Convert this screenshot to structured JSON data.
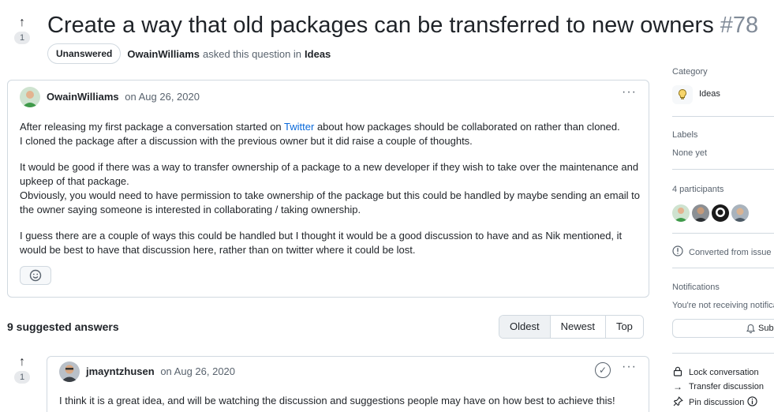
{
  "discussion": {
    "upvotes": "1",
    "title": "Create a way that old packages can be transferred to new owners",
    "number": "#78",
    "status": "Unanswered",
    "asker": "OwainWilliams",
    "asked_text": "asked this question in",
    "category": "Ideas"
  },
  "post": {
    "author": "OwainWilliams",
    "date": "on Aug 26, 2020",
    "more_icon": "kebab-horizontal-icon",
    "p1_before": "After releasing my first package a conversation started on ",
    "p1_link": "Twitter",
    "p1_after": " about how packages should be collaborated on rather than cloned.",
    "p1_line2": "I cloned the package after a discussion with the previous owner but it did raise a couple of thoughts.",
    "p2_line1": "It would be good if there was a way to transfer ownership of a package to a new developer if they wish to take over the maintenance and upkeep of that package.",
    "p2_line2": "Obviously, you would need to have permission to take ownership of the package but this could be handled by maybe sending an email to the owner saying someone is interested in collaborating / taking ownership.",
    "p3": "I guess there are a couple of ways this could be handled but I thought it would be a good discussion to have and as Nik mentioned, it would be best to have that discussion here, rather than on twitter where it could be lost.",
    "reaction_icon": "smiley-icon"
  },
  "answers": {
    "heading": "9 suggested answers",
    "sort": [
      "Oldest",
      "Newest",
      "Top"
    ],
    "first": {
      "upvotes": "1",
      "author": "jmayntzhusen",
      "date": "on Aug 26, 2020",
      "text": "I think it is a great idea, and will be watching the discussion and suggestions people may have on how best to achieve this!"
    }
  },
  "sidebar": {
    "category_label": "Category",
    "category_value": "Ideas",
    "category_icon": "lightbulb-icon",
    "labels_label": "Labels",
    "labels_value": "None yet",
    "participants_label": "4 participants",
    "converted_text": "Converted from issue",
    "notifications_label": "Notifications",
    "notifications_text": "You're not receiving notifica",
    "subscribe_label": "Sub",
    "lock_text": "Lock conversation",
    "transfer_text": "Transfer discussion",
    "pin_text": "Pin discussion"
  },
  "colors": {
    "link": "#0969da",
    "border": "#d1d9e0",
    "muted": "#59636e",
    "text": "#1f2328"
  }
}
